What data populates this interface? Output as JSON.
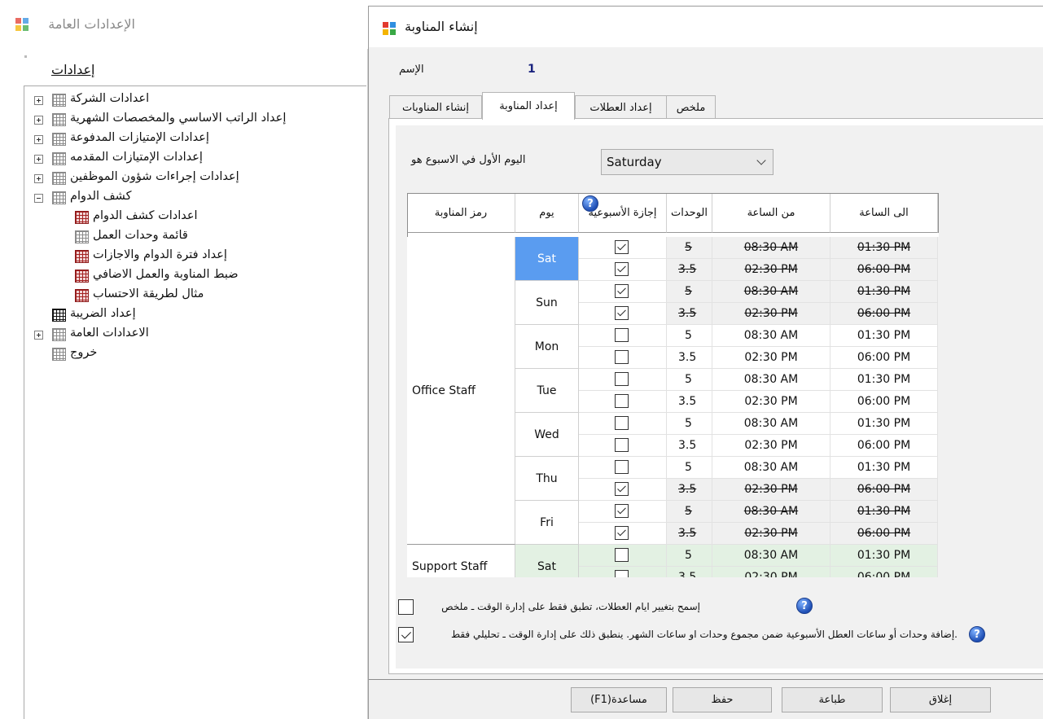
{
  "left_window": {
    "title": "الإعدادات العامة",
    "heading": "إعدادات",
    "tree": [
      {
        "label": "اعدادات الشركة",
        "expander": "closed",
        "icon": "grid"
      },
      {
        "label": "إعداد الراتب الاساسي والمخصصات الشهرية",
        "expander": "closed",
        "icon": "grid"
      },
      {
        "label": "إعدادات الإمتيازات المدفوعة",
        "expander": "closed",
        "icon": "grid"
      },
      {
        "label": "إعدادات الإمتيازات المقدمه",
        "expander": "closed",
        "icon": "grid"
      },
      {
        "label": "إعدادات إجراءات شؤون الموظفين",
        "expander": "closed",
        "icon": "grid"
      },
      {
        "label": "كشف الدوام",
        "expander": "open",
        "icon": "grid"
      },
      {
        "label": "اعدادات كشف الدوام",
        "child": true,
        "icon": "grid-red"
      },
      {
        "label": "قائمة وحدات العمل",
        "child": true,
        "icon": "grid"
      },
      {
        "label": "إعداد فترة الدوام والاجازات",
        "child": true,
        "icon": "grid-red"
      },
      {
        "label": "ضبط المناوبة والعمل الاضافي",
        "child": true,
        "icon": "grid-red"
      },
      {
        "label": "مثال لطريقة الاحتساب",
        "child": true,
        "icon": "grid-red"
      },
      {
        "label": "إعداد الضريبة",
        "expander": "none",
        "icon": "grid-black"
      },
      {
        "label": "الاعدادات العامة",
        "expander": "closed",
        "icon": "grid"
      },
      {
        "label": "خروج",
        "expander": "none",
        "icon": "grid"
      }
    ]
  },
  "dialog": {
    "title": "إنشاء المناوبة",
    "name_label": "الإسم",
    "name_value": "1",
    "tabs": [
      {
        "label": "إنشاء المناوبات",
        "active": false
      },
      {
        "label": "إعداد المناوبة",
        "active": true
      },
      {
        "label": "إعداد العطلات",
        "active": false
      },
      {
        "label": "ملخص",
        "active": false
      }
    ],
    "first_day_label": "اليوم الأول في الاسبوع هو",
    "first_day_value": "Saturday",
    "grid": {
      "headers": {
        "code": "رمز المناوبة",
        "day": "يوم",
        "weekly_off": "إجازة الأسبوعية",
        "units": "الوحدات",
        "from": "من الساعة",
        "to": "الى الساعة"
      },
      "groups": [
        {
          "code": "Office Staff",
          "days": [
            {
              "day": "Sat",
              "selected": true,
              "rows": [
                {
                  "off": true,
                  "units": "5",
                  "from": "08:30 AM",
                  "to": "01:30 PM"
                },
                {
                  "off": true,
                  "units": "3.5",
                  "from": "02:30 PM",
                  "to": "06:00 PM"
                }
              ]
            },
            {
              "day": "Sun",
              "rows": [
                {
                  "off": true,
                  "units": "5",
                  "from": "08:30 AM",
                  "to": "01:30 PM"
                },
                {
                  "off": true,
                  "units": "3.5",
                  "from": "02:30 PM",
                  "to": "06:00 PM"
                }
              ]
            },
            {
              "day": "Mon",
              "rows": [
                {
                  "off": false,
                  "units": "5",
                  "from": "08:30 AM",
                  "to": "01:30 PM"
                },
                {
                  "off": false,
                  "units": "3.5",
                  "from": "02:30 PM",
                  "to": "06:00 PM"
                }
              ]
            },
            {
              "day": "Tue",
              "rows": [
                {
                  "off": false,
                  "units": "5",
                  "from": "08:30 AM",
                  "to": "01:30 PM"
                },
                {
                  "off": false,
                  "units": "3.5",
                  "from": "02:30 PM",
                  "to": "06:00 PM"
                }
              ]
            },
            {
              "day": "Wed",
              "rows": [
                {
                  "off": false,
                  "units": "5",
                  "from": "08:30 AM",
                  "to": "01:30 PM"
                },
                {
                  "off": false,
                  "units": "3.5",
                  "from": "02:30 PM",
                  "to": "06:00 PM"
                }
              ]
            },
            {
              "day": "Thu",
              "rows": [
                {
                  "off": false,
                  "units": "5",
                  "from": "08:30 AM",
                  "to": "01:30 PM"
                },
                {
                  "off": true,
                  "units": "3.5",
                  "from": "02:30 PM",
                  "to": "06:00 PM"
                }
              ]
            },
            {
              "day": "Fri",
              "rows": [
                {
                  "off": true,
                  "units": "5",
                  "from": "08:30 AM",
                  "to": "01:30 PM"
                },
                {
                  "off": true,
                  "units": "3.5",
                  "from": "02:30 PM",
                  "to": "06:00 PM"
                }
              ]
            }
          ]
        },
        {
          "code": "Support Staff",
          "days": [
            {
              "day": "Sat",
              "rows": [
                {
                  "off": false,
                  "units": "5",
                  "from": "08:30 AM",
                  "to": "01:30 PM"
                },
                {
                  "off": false,
                  "units": "3.5",
                  "from": "02:30 PM",
                  "to": "06:00 PM"
                }
              ]
            }
          ]
        }
      ]
    },
    "options": [
      {
        "text": "إسمح بتغيير ايام العطلات، تطبق فقط على إدارة الوقت ـ ملخص",
        "checked": false
      },
      {
        "text": ".إضافة وحدات أو ساعات العطل الأسبوعية ضمن مجموع وحدات او ساعات الشهر. ينطبق ذلك على إدارة الوقت ـ تحليلي فقط",
        "checked": true
      }
    ],
    "buttons": {
      "help": "(F1)مساعدة",
      "save": "حفظ",
      "print": "طباعة",
      "close": "إغلاق"
    },
    "colors": {
      "selected_day": "#5a9cf0",
      "off_row": "#f0f0f0",
      "support_row": "#e3f1e3"
    }
  }
}
